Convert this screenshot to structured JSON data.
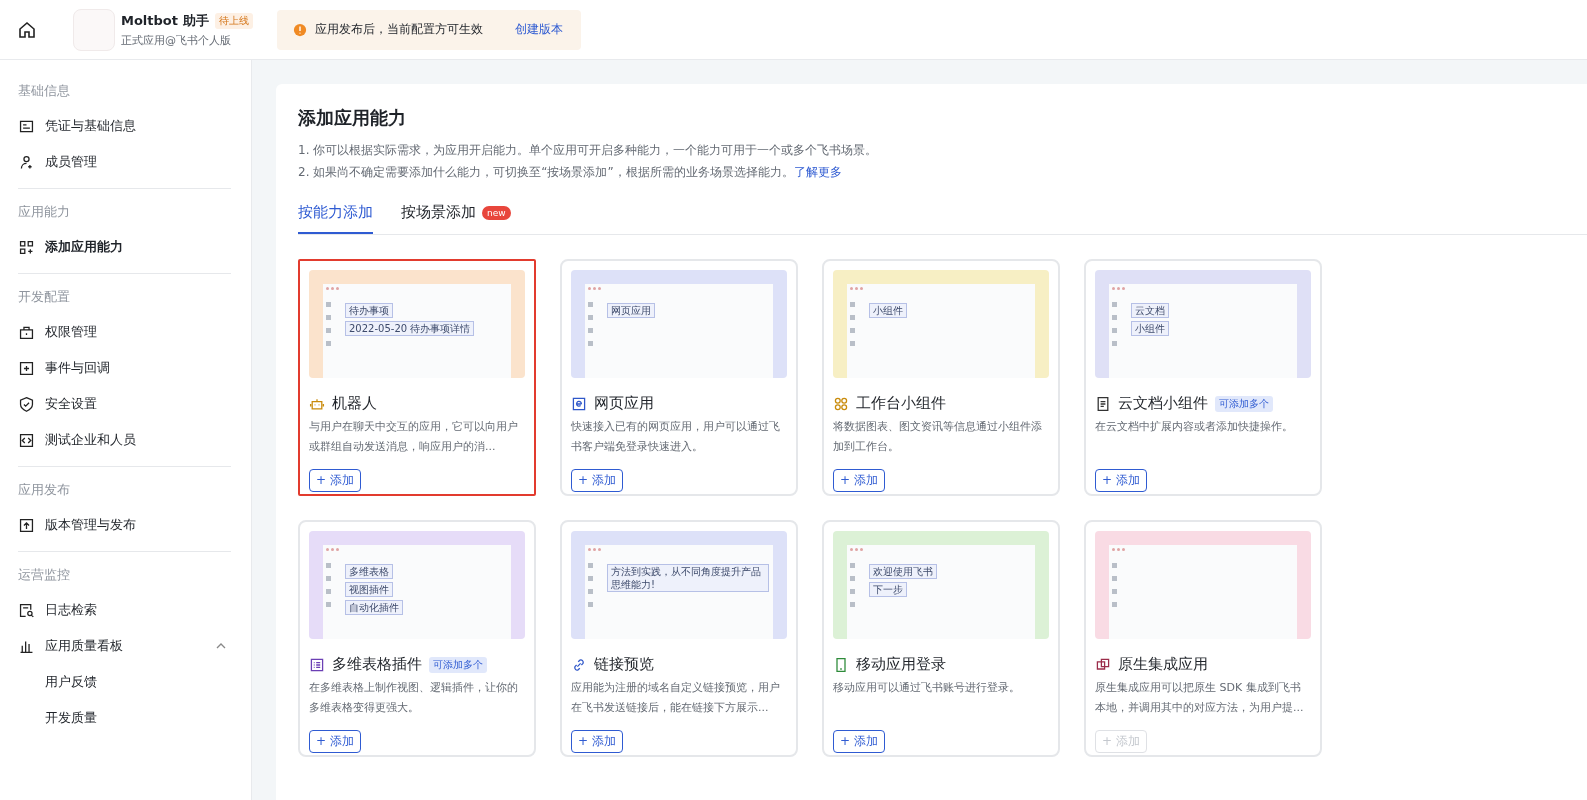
{
  "topbar": {
    "app_name": "Moltbot 助手",
    "status_tag": "待上线",
    "app_subtitle": "正式应用@飞书个人版",
    "notice": {
      "text": "应用发布后，当前配置方可生效",
      "link": "创建版本"
    }
  },
  "sidebar": {
    "sections": [
      {
        "title": "基础信息",
        "items": [
          {
            "label": "凭证与基础信息",
            "selected": false
          },
          {
            "label": "成员管理",
            "selected": false
          }
        ]
      },
      {
        "title": "应用能力",
        "items": [
          {
            "label": "添加应用能力",
            "selected": true
          }
        ]
      },
      {
        "title": "开发配置",
        "items": [
          {
            "label": "权限管理",
            "selected": false
          },
          {
            "label": "事件与回调",
            "selected": false
          },
          {
            "label": "安全设置",
            "selected": false
          },
          {
            "label": "测试企业和人员",
            "selected": false
          }
        ]
      },
      {
        "title": "应用发布",
        "items": [
          {
            "label": "版本管理与发布",
            "selected": false
          }
        ]
      },
      {
        "title": "运营监控",
        "items": [
          {
            "label": "日志检索",
            "selected": false
          },
          {
            "label": "应用质量看板",
            "selected": false,
            "expanded": true,
            "children": [
              {
                "label": "用户反馈",
                "selected": false
              },
              {
                "label": "开发质量",
                "selected": false
              }
            ]
          }
        ]
      }
    ]
  },
  "main": {
    "title": "添加应用能力",
    "notes": [
      "1. 你可以根据实际需求，为应用开启能力。单个应用可开启多种能力，一个能力可用于一个或多个飞书场景。",
      "2. 如果尚不确定需要添加什么能力，可切换至“按场景添加”，根据所需的业务场景选择能力。"
    ],
    "learn_more": "了解更多",
    "tabs": [
      {
        "label": "按能力添加",
        "selected": true
      },
      {
        "label": "按场景添加",
        "selected": false,
        "badge": "new"
      }
    ],
    "cards": [
      {
        "title": "机器人",
        "description": "与用户在聊天中交互的应用，它可以向用户或群组自动发送消息，响应用户的消...",
        "add": "+ 添加",
        "disabled": false,
        "highlighted": true,
        "preview": {
          "color": "#fbe3cc",
          "labels": [
            "待办事项",
            "2022-05-20 待办事项详情"
          ]
        }
      },
      {
        "title": "网页应用",
        "description": "快速接入已有的网页应用，用户可以通过飞书客户端免登录快速进入。",
        "add": "+ 添加",
        "disabled": false,
        "highlighted": false,
        "preview": {
          "color": "#dde1f8",
          "labels": [
            "网页应用"
          ]
        }
      },
      {
        "title": "工作台小组件",
        "description": "将数据图表、图文资讯等信息通过小组件添加到工作台。",
        "add": "+ 添加",
        "disabled": false,
        "highlighted": false,
        "preview": {
          "color": "#f7efc4",
          "labels": [
            "小组件"
          ]
        }
      },
      {
        "title": "云文档小组件",
        "tag": "可添加多个",
        "description": "在云文档中扩展内容或者添加快捷操作。",
        "add": "+ 添加",
        "disabled": false,
        "highlighted": false,
        "preview": {
          "color": "#dfe0f6",
          "labels": [
            "云文档",
            "小组件"
          ]
        }
      },
      {
        "title": "多维表格插件",
        "tag": "可添加多个",
        "description": "在多维表格上制作视图、逻辑插件，让你的多维表格变得更强大。",
        "add": "+ 添加",
        "disabled": false,
        "highlighted": false,
        "preview": {
          "color": "#e6dcf8",
          "labels": [
            "多维表格",
            "视图插件",
            "自动化插件"
          ]
        }
      },
      {
        "title": "链接预览",
        "description": "应用能为注册的域名自定义链接预览，用户在飞书发送链接后，能在链接下方展示...",
        "add": "+ 添加",
        "disabled": false,
        "highlighted": false,
        "preview": {
          "color": "#dde1f8",
          "labels": [
            "方法到实践，从不同角度提升产品思维能力!"
          ]
        }
      },
      {
        "title": "移动应用登录",
        "description": "移动应用可以通过飞书账号进行登录。",
        "add": "+ 添加",
        "disabled": false,
        "highlighted": false,
        "preview": {
          "color": "#dcf1d6",
          "labels": [
            "欢迎使用飞书",
            "下一步"
          ]
        }
      },
      {
        "title": "原生集成应用",
        "description": "原生集成应用可以把原生 SDK 集成到飞书本地，并调用其中的对应方法，为用户提...",
        "add": "+ 添加",
        "disabled": true,
        "highlighted": false,
        "preview": {
          "color": "#f9dbe4"
        }
      }
    ]
  }
}
